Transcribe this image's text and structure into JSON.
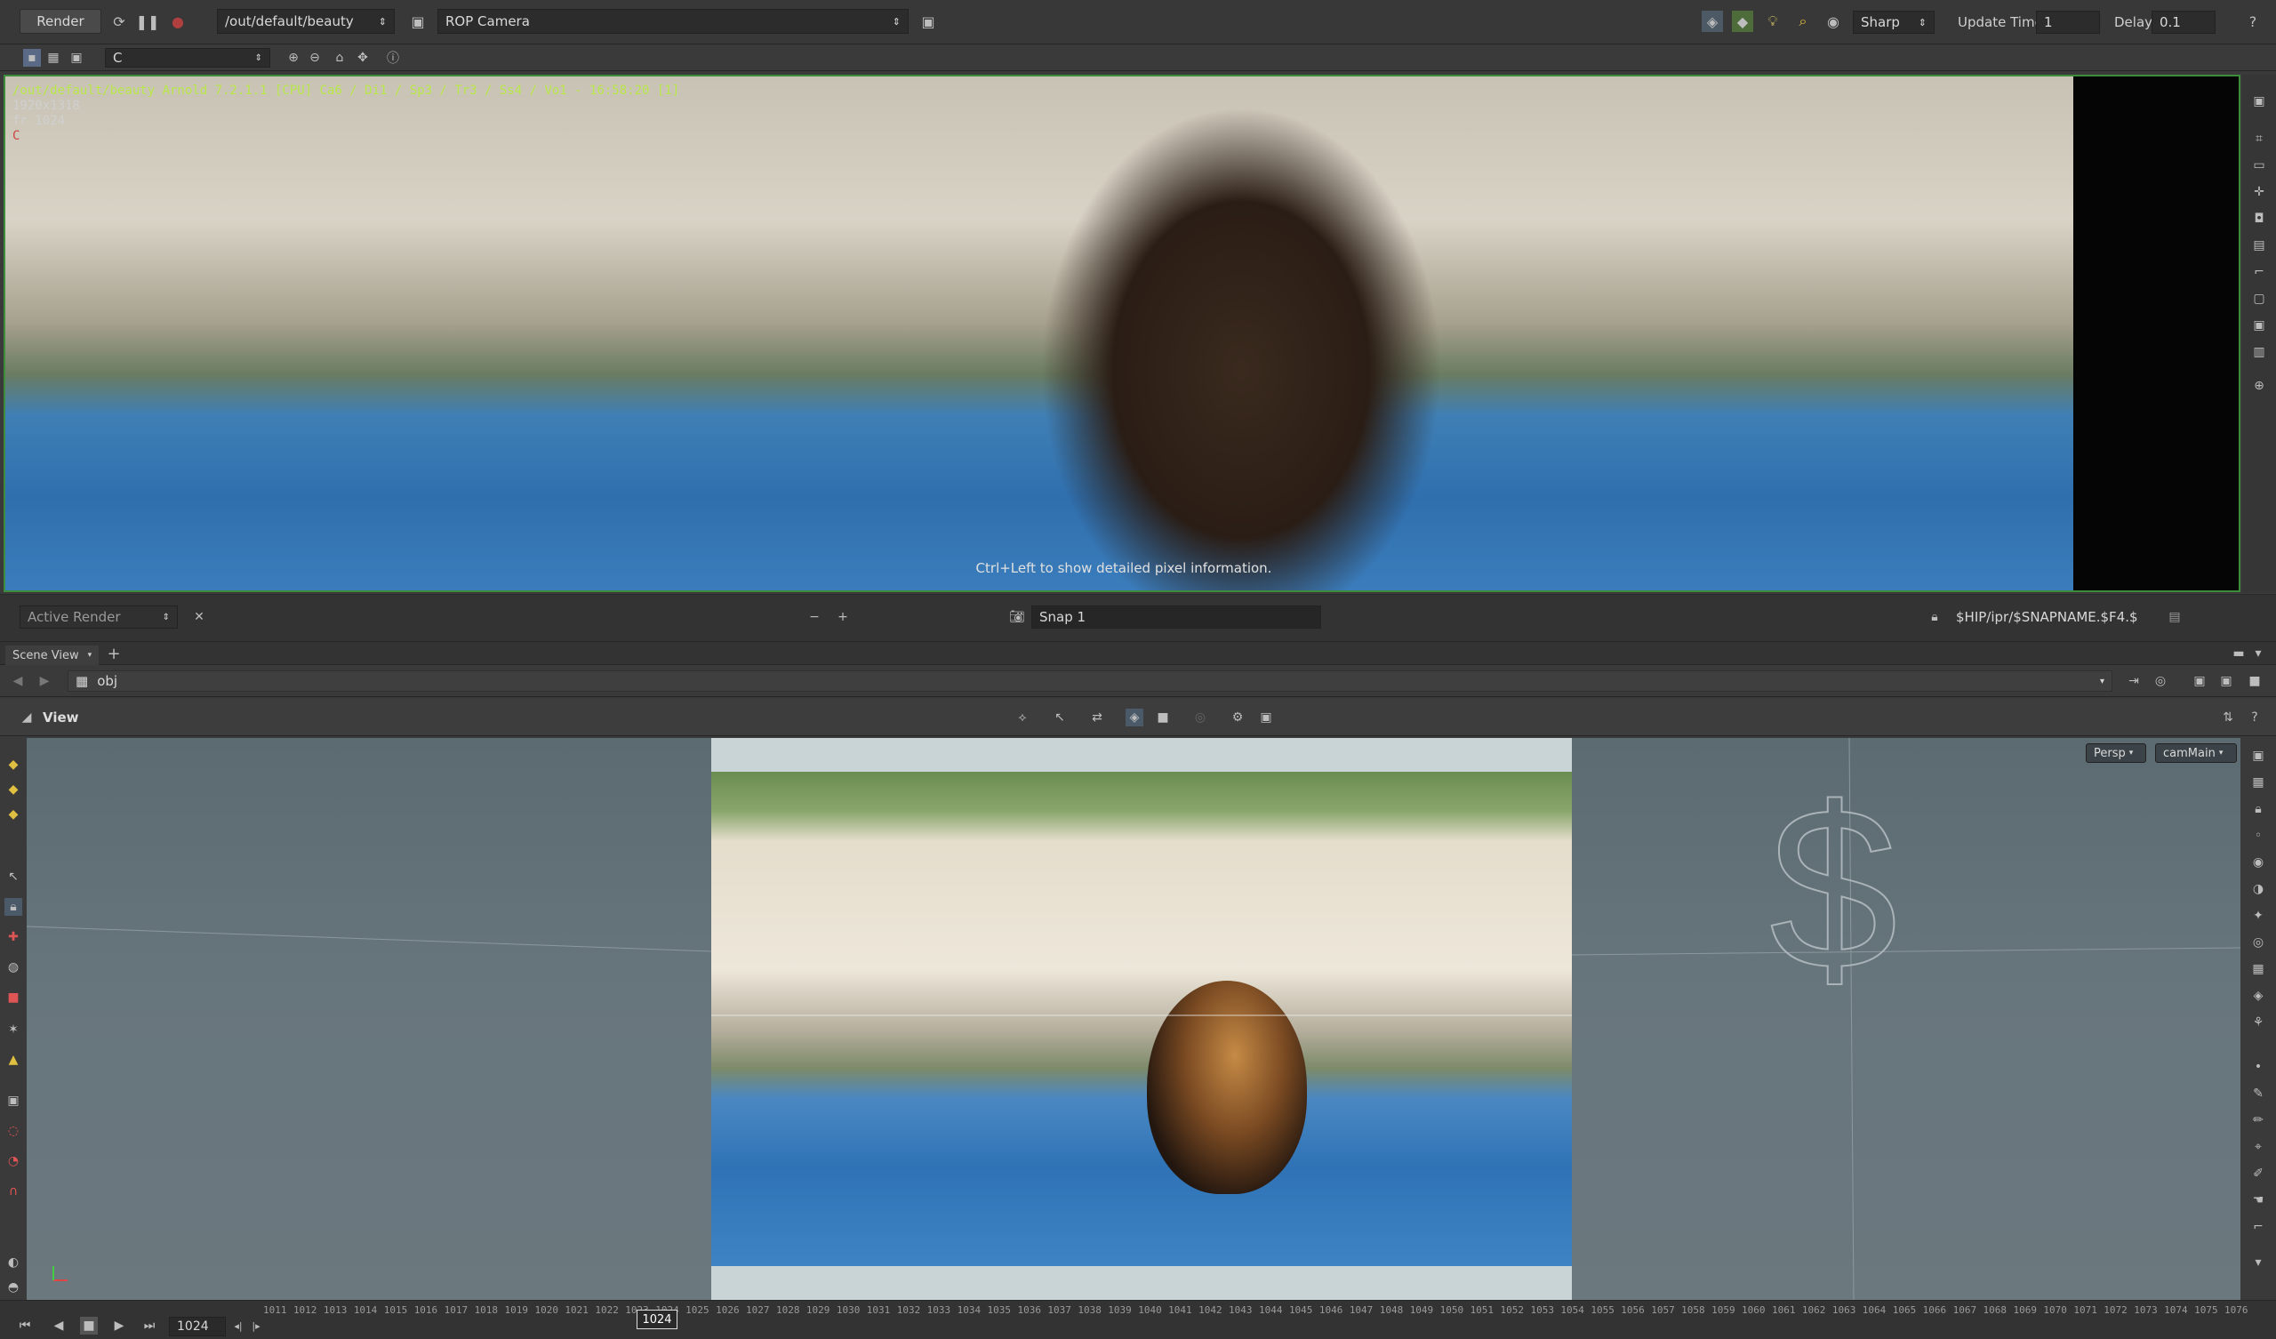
{
  "toolbar": {
    "render_label": "Render",
    "output_path": "/out/default/beauty",
    "camera": "ROP Camera",
    "shading_mode": "Sharp",
    "update_time_label": "Update Time",
    "update_time_value": "1",
    "delay_label": "Delay",
    "delay_value": "0.1",
    "aov_field": "C"
  },
  "render_view": {
    "info_line1": "/out/default/beauty  Arnold 7.2.1.1 [CPU] Ca6 / Di1 / Sp3 / Tr3 / Ss4 / Vo1 - 16:58:20 [1]",
    "resolution": "1920x1318",
    "frame": "fr 1024",
    "channel": "C",
    "hint": "Ctrl+Left to show detailed pixel information."
  },
  "snapshot_bar": {
    "active_render": "Active Render",
    "snap_name": "Snap 1",
    "snap_path": "$HIP/ipr/$SNAPNAME.$F4.$"
  },
  "scene": {
    "tab_label": "Scene View",
    "network_path": "obj",
    "view_label": "View",
    "persp_menu": "Persp",
    "cam_menu": "camMain",
    "watermark_glyph": "$"
  },
  "timeline": {
    "current_frame": "1024",
    "marker": "1024",
    "ticks": [
      "1011",
      "1012",
      "1013",
      "1014",
      "1015",
      "1016",
      "1017",
      "1018",
      "1019",
      "1020",
      "1021",
      "1022",
      "1023",
      "1024",
      "1025",
      "1026",
      "1027",
      "1028",
      "1029",
      "1030",
      "1031",
      "1032",
      "1033",
      "1034",
      "1035",
      "1036",
      "1037",
      "1038",
      "1039",
      "1040",
      "1041",
      "1042",
      "1043",
      "1044",
      "1045",
      "1046",
      "1047",
      "1048",
      "1049",
      "1050",
      "1051",
      "1052",
      "1053",
      "1054",
      "1055",
      "1056",
      "1057",
      "1058",
      "1059",
      "1060",
      "1061",
      "1062",
      "1063",
      "1064",
      "1065",
      "1066",
      "1067",
      "1068",
      "1069",
      "1070",
      "1071",
      "1072",
      "1073",
      "1074",
      "1075",
      "1076"
    ]
  },
  "colors": {
    "accent_green": "#3c8c3c",
    "info_text": "#b9e84a"
  }
}
